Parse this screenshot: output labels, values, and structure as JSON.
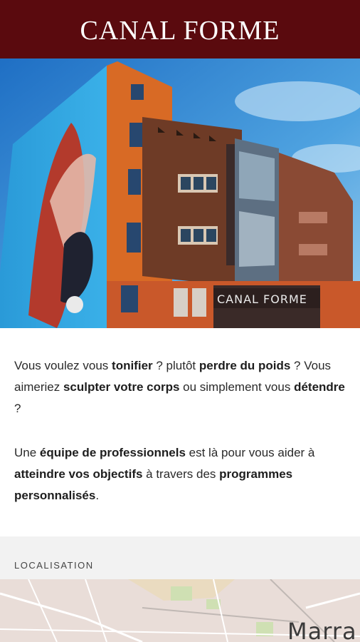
{
  "header": {
    "brand": "CANAL FORME"
  },
  "hero": {
    "sign_text": "CANAL FORME"
  },
  "intro": {
    "p1": [
      {
        "t": "Vous voulez vous ",
        "b": false
      },
      {
        "t": "tonifier",
        "b": true
      },
      {
        "t": " ? plutôt ",
        "b": false
      },
      {
        "t": "perdre du poids",
        "b": true
      },
      {
        "t": " ? Vous aimeriez ",
        "b": false
      },
      {
        "t": "sculpter votre corps",
        "b": true
      },
      {
        "t": " ou simplement vous ",
        "b": false
      },
      {
        "t": "détendre",
        "b": true
      },
      {
        "t": " ?",
        "b": false
      }
    ],
    "p2": [
      {
        "t": "Une ",
        "b": false
      },
      {
        "t": "équipe de professionnels",
        "b": true
      },
      {
        "t": " est là pour vous aider à ",
        "b": false
      },
      {
        "t": "atteindre vos objectifs",
        "b": true
      },
      {
        "t": " à travers des ",
        "b": false
      },
      {
        "t": "programmes personnalisés",
        "b": true
      },
      {
        "t": ".",
        "b": false
      }
    ]
  },
  "location": {
    "title": "LOCALISATION",
    "map_label": "Marra"
  },
  "colors": {
    "header_bg": "#5a0a0e",
    "section_bg": "#f2f2f2",
    "map_bg": "#e9ddd8"
  }
}
